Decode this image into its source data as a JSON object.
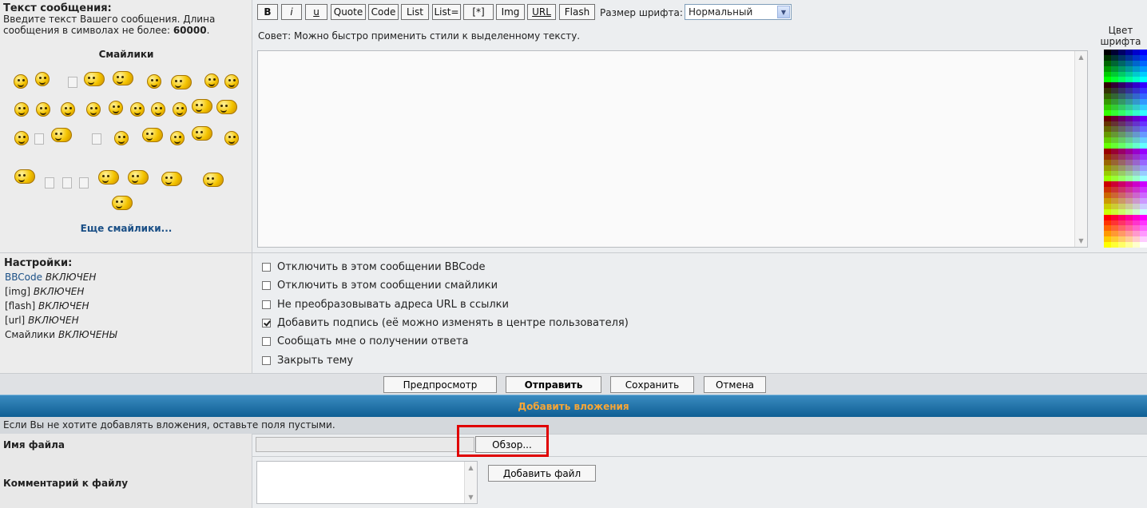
{
  "message": {
    "title": "Текст сообщения:",
    "desc_prefix": "Введите текст Вашего сообщения. Длина сообщения в символах не более: ",
    "max_length": "60000",
    "desc_suffix": "."
  },
  "smilies": {
    "title": "Смайлики",
    "more_link": "Еще смайлики..."
  },
  "toolbar": {
    "bold": "B",
    "italic": "i",
    "underline": "u",
    "quote": "Quote",
    "code": "Code",
    "list": "List",
    "list_eq": "List=",
    "list_item": "[*]",
    "img": "Img",
    "url": "URL",
    "flash": "Flash",
    "font_size_label": "Размер шрифта:",
    "font_size_value": "Нормальный"
  },
  "tip": "Совет: Можно быстро применить стили к выделенному тексту.",
  "color_palette": {
    "title": "Цвет шрифта"
  },
  "settings": {
    "title": "Настройки:",
    "bbcode_label": "BBCode",
    "bbcode_state": "ВКЛЮЧЕН",
    "img_label": "[img]",
    "img_state": "ВКЛЮЧЕН",
    "flash_label": "[flash]",
    "flash_state": "ВКЛЮЧЕН",
    "url_label": "[url]",
    "url_state": "ВКЛЮЧЕН",
    "smilies_label": "Смайлики",
    "smilies_state": "ВКЛЮЧЕНЫ"
  },
  "options": [
    {
      "label": "Отключить в этом сообщении BBCode",
      "checked": false
    },
    {
      "label": "Отключить в этом сообщении смайлики",
      "checked": false
    },
    {
      "label": "Не преобразовывать адреса URL в ссылки",
      "checked": false
    },
    {
      "label": "Добавить подпись (её можно изменять в центре пользователя)",
      "checked": true
    },
    {
      "label": "Сообщать мне о получении ответа",
      "checked": false
    },
    {
      "label": "Закрыть тему",
      "checked": false
    }
  ],
  "actions": {
    "preview": "Предпросмотр",
    "send": "Отправить",
    "save": "Сохранить",
    "cancel": "Отмена"
  },
  "attachments": {
    "header": "Добавить вложения",
    "hint": "Если Вы не хотите добавлять вложения, оставьте поля пустыми.",
    "file_label": "Имя файла",
    "browse": "Обзор...",
    "comment_label": "Комментарий к файлу",
    "add_file": "Добавить файл"
  },
  "colors": {
    "header_bg": "#0f5f94",
    "header_text": "#f7a637",
    "link": "#1a4f86",
    "highlight": "#e00000"
  }
}
